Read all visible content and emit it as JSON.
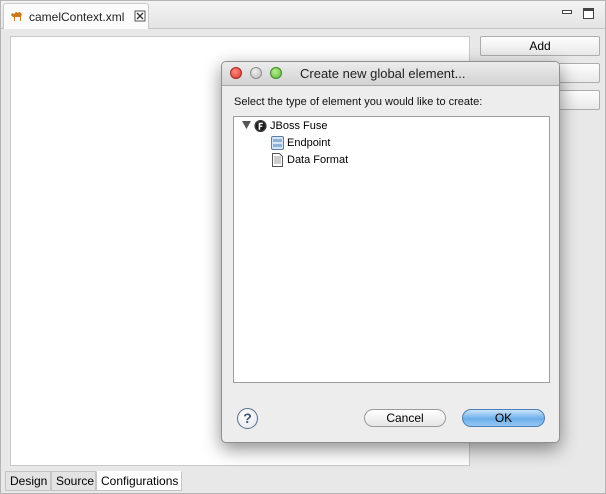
{
  "editor": {
    "tab_title": "camelContext.xml",
    "side_buttons": [
      "Add",
      "",
      ""
    ],
    "bottom_tabs": [
      "Design",
      "Source",
      "Configurations"
    ],
    "active_bottom_tab": "Configurations"
  },
  "dialog": {
    "title": "Create new global element...",
    "prompt": "Select the type of element you would like to create:",
    "tree": {
      "root": "JBoss Fuse",
      "children": [
        "Endpoint",
        "Data Format"
      ]
    },
    "cancel_label": "Cancel",
    "ok_label": "OK",
    "help_label": "?"
  },
  "colors": {
    "close_red": "#d8372c",
    "zoom_green": "#5eb53a",
    "ok_blue": "#6daee9"
  }
}
